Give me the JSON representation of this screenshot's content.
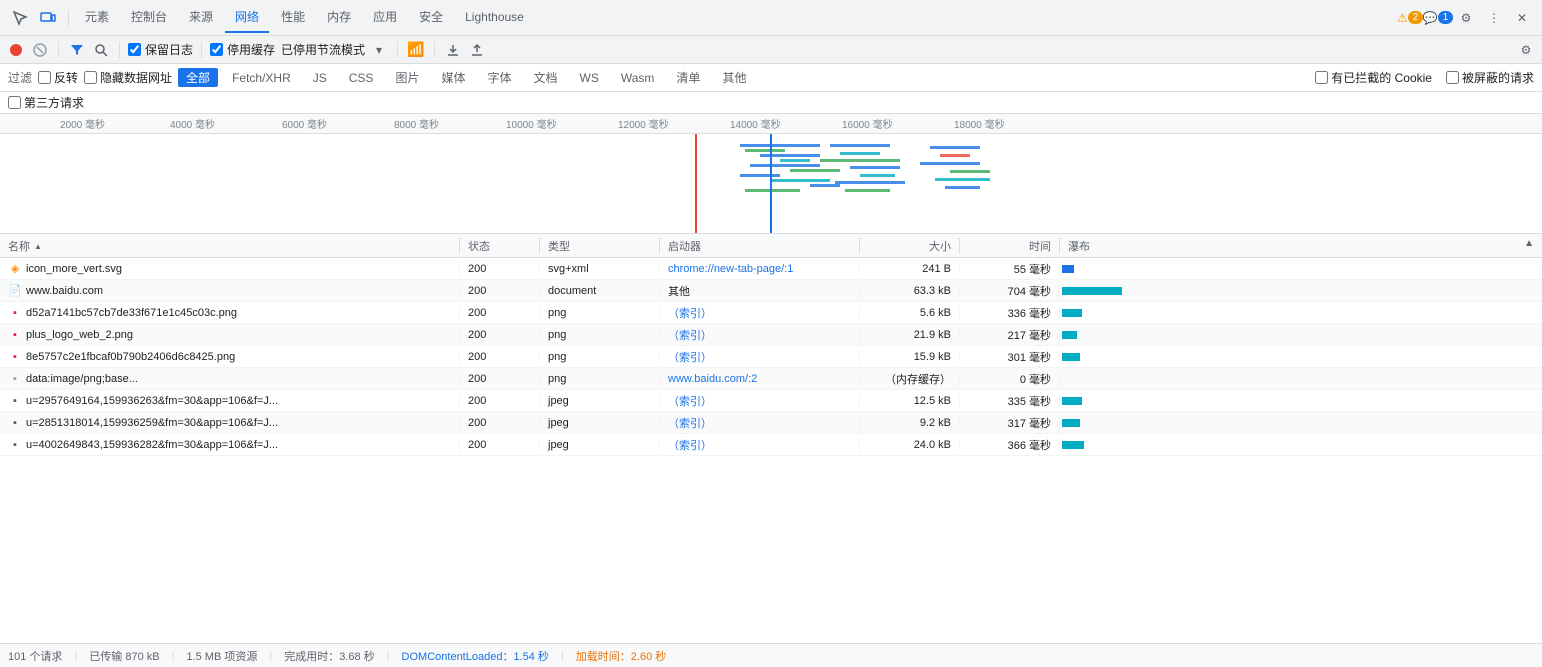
{
  "tabs": {
    "items": [
      {
        "label": "元素",
        "active": false
      },
      {
        "label": "控制台",
        "active": false
      },
      {
        "label": "来源",
        "active": false
      },
      {
        "label": "网络",
        "active": true
      },
      {
        "label": "性能",
        "active": false
      },
      {
        "label": "内存",
        "active": false
      },
      {
        "label": "应用",
        "active": false
      },
      {
        "label": "安全",
        "active": false
      },
      {
        "label": "Lighthouse",
        "active": false
      }
    ],
    "warning_count": "2",
    "message_count": "1"
  },
  "toolbar": {
    "preserve_log_label": "保留日志",
    "disable_cache_label": "停用缓存",
    "throttle_label": "已停用节流模式"
  },
  "filter_bar": {
    "label": "过滤",
    "invert_label": "反转",
    "hide_data_urls_label": "隐藏数据网址",
    "all_label": "全部",
    "types": [
      "Fetch/XHR",
      "JS",
      "CSS",
      "图片",
      "媒体",
      "字体",
      "文档",
      "WS",
      "Wasm",
      "清单",
      "其他"
    ],
    "has_blocked_cookies_label": "有已拦截的 Cookie",
    "blocked_requests_label": "被屏蔽的请求"
  },
  "third_party_label": "第三方请求",
  "timeline": {
    "ticks": [
      "2000 毫秒",
      "4000 毫秒",
      "6000 毫秒",
      "8000 毫秒",
      "10000 毫秒",
      "12000 毫秒",
      "14000 毫秒",
      "16000 毫秒",
      "18000 毫秒"
    ]
  },
  "table": {
    "headers": {
      "name": "名称",
      "status": "状态",
      "type": "类型",
      "initiator": "启动器",
      "size": "大小",
      "time": "时间",
      "waterfall": "瀑布"
    },
    "rows": [
      {
        "name": "icon_more_vert.svg",
        "status": "200",
        "type": "svg+xml",
        "initiator": "chrome://new-tab-page/:1",
        "initiator_link": true,
        "size": "241 B",
        "time": "55 毫秒",
        "icon": "svg"
      },
      {
        "name": "www.baidu.com",
        "status": "200",
        "type": "document",
        "initiator": "其他",
        "initiator_link": false,
        "size": "63.3 kB",
        "time": "704 毫秒",
        "icon": "doc"
      },
      {
        "name": "d52a7141bc57cb7de33f671e1c45c03c.png",
        "status": "200",
        "type": "png",
        "initiator": "（索引）",
        "initiator_link": true,
        "size": "5.6 kB",
        "time": "336 毫秒",
        "icon": "img"
      },
      {
        "name": "plus_logo_web_2.png",
        "status": "200",
        "type": "png",
        "initiator": "（索引）",
        "initiator_link": true,
        "size": "21.9 kB",
        "time": "217 毫秒",
        "icon": "img"
      },
      {
        "name": "8e5757c2e1fbcaf0b790b2406d6c8425.png",
        "status": "200",
        "type": "png",
        "initiator": "（索引）",
        "initiator_link": true,
        "size": "15.9 kB",
        "time": "301 毫秒",
        "icon": "img"
      },
      {
        "name": "data:image/png;base...",
        "status": "200",
        "type": "png",
        "initiator": "www.baidu.com/:2",
        "initiator_link": true,
        "size": "（内存缓存）",
        "time": "0 毫秒",
        "icon": "data"
      },
      {
        "name": "u=2957649164,159936263&fm=30&app=106&f=J...",
        "status": "200",
        "type": "jpeg",
        "initiator": "（索引）",
        "initiator_link": true,
        "size": "12.5 kB",
        "time": "335 毫秒",
        "icon": "jpeg"
      },
      {
        "name": "u=2851318014,159936259&fm=30&app=106&f=J...",
        "status": "200",
        "type": "jpeg",
        "initiator": "（索引）",
        "initiator_link": true,
        "size": "9.2 kB",
        "time": "317 毫秒",
        "icon": "jpeg"
      },
      {
        "name": "u=4002649843,159936282&fm=30&app=106&f=J...",
        "status": "200",
        "type": "jpeg",
        "initiator": "（索引）",
        "initiator_link": true,
        "size": "24.0 kB",
        "time": "366 毫秒",
        "icon": "jpeg"
      }
    ]
  },
  "status_bar": {
    "request_count": "101 个请求",
    "transferred": "已传输 870 kB",
    "resources": "1.5 MB 项资源",
    "finish_time": "完成用时：3.68 秒",
    "dom_content_loaded": "DOMContentLoaded：1.54 秒",
    "load_time": "加载时间：2.60 秒"
  }
}
